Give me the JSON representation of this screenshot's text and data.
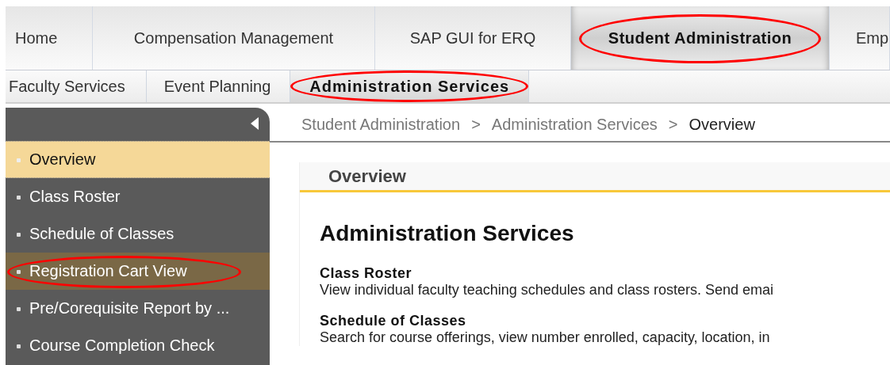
{
  "tabs": [
    {
      "label": "Home",
      "selected": false,
      "circled": false
    },
    {
      "label": "Compensation Management",
      "selected": false,
      "circled": false
    },
    {
      "label": "SAP GUI for ERQ",
      "selected": false,
      "circled": false
    },
    {
      "label": "Student Administration",
      "selected": true,
      "circled": true
    },
    {
      "label": "Emp",
      "selected": false,
      "circled": false
    }
  ],
  "subtabs": [
    {
      "label": "Faculty Services",
      "selected": false,
      "circled": false
    },
    {
      "label": "Event Planning",
      "selected": false,
      "circled": false
    },
    {
      "label": "Administration Services",
      "selected": true,
      "circled": true
    }
  ],
  "sidebar": {
    "items": [
      {
        "label": "Overview",
        "selected": true,
        "highlighted": false,
        "circled": false
      },
      {
        "label": "Class Roster",
        "selected": false,
        "highlighted": false,
        "circled": false
      },
      {
        "label": "Schedule of Classes",
        "selected": false,
        "highlighted": false,
        "circled": false
      },
      {
        "label": "Registration Cart View",
        "selected": false,
        "highlighted": true,
        "circled": true
      },
      {
        "label": "Pre/Corequisite Report by ...",
        "selected": false,
        "highlighted": false,
        "circled": false
      },
      {
        "label": "Course Completion Check",
        "selected": false,
        "highlighted": false,
        "circled": false
      }
    ]
  },
  "breadcrumb": {
    "separator": ">",
    "items": [
      "Student Administration",
      "Administration Services",
      "Overview"
    ]
  },
  "panel": {
    "title": "Overview",
    "heading": "Administration Services",
    "sections": [
      {
        "title": "Class Roster",
        "text": "View individual faculty teaching schedules and class rosters. Send emai"
      },
      {
        "title": "Schedule of Classes",
        "text": "Search for course offerings, view number enrolled, capacity, location, in"
      }
    ]
  }
}
